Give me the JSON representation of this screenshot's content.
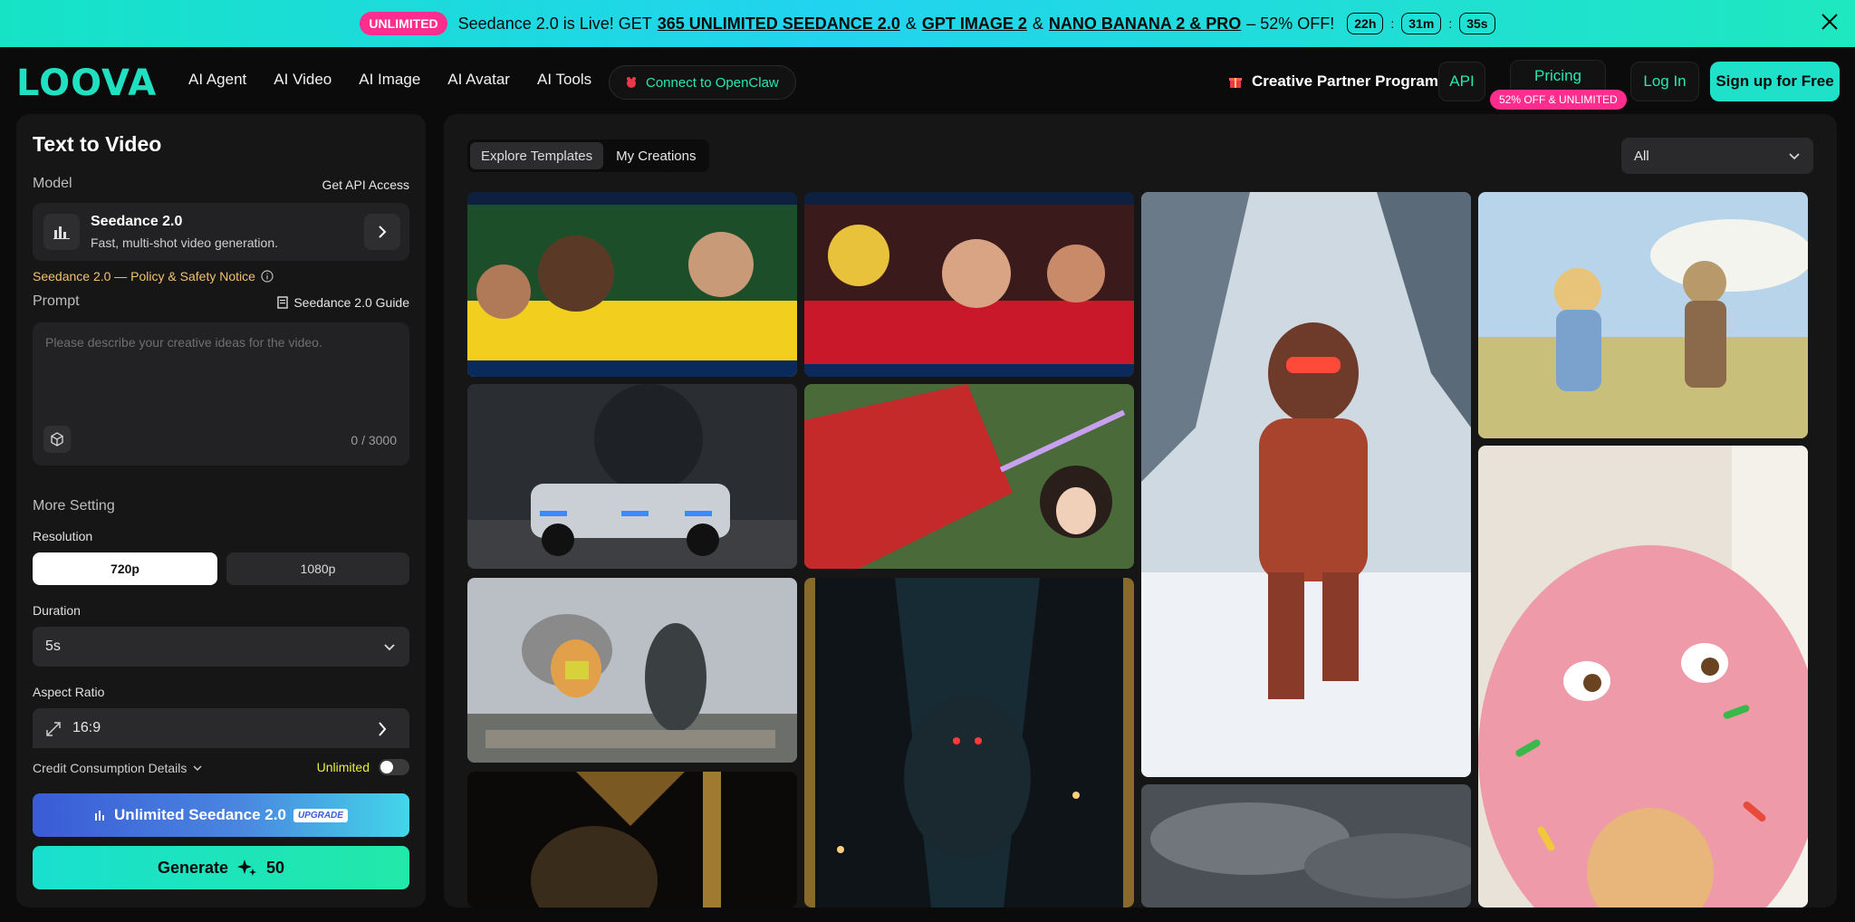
{
  "promo": {
    "badge": "UNLIMITED",
    "text_pre": "Seedance 2.0 is Live! GET",
    "link1": "365 UNLIMITED SEEDANCE 2.0",
    "amp1": "&",
    "link2": "GPT IMAGE 2",
    "amp2": "&",
    "link3": "NANO BANANA 2 & PRO",
    "text_post": "– 52% OFF!",
    "timer": {
      "hours": "22h",
      "minutes": "31m",
      "seconds": "35s",
      "sep": ":"
    }
  },
  "nav": {
    "logo": "LOOVA",
    "links": [
      "AI Agent",
      "AI Video",
      "AI Image",
      "AI Avatar",
      "AI Tools"
    ],
    "openclaw": "Connect to OpenClaw",
    "partner": "Creative Partner Program",
    "api": "API",
    "pricing": "Pricing",
    "pricing_badge": "52% OFF & UNLIMITED",
    "login": "Log In",
    "signup": "Sign up for Free"
  },
  "panel": {
    "title": "Text to Video",
    "model_label": "Model",
    "api_access": "Get API Access",
    "model_name": "Seedance 2.0",
    "model_desc": "Fast, multi-shot video generation.",
    "policy": "Seedance 2.0 — Policy & Safety Notice",
    "prompt_label": "Prompt",
    "guide": "Seedance 2.0 Guide",
    "prompt_placeholder": "Please describe your creative ideas for the video.",
    "counter": "0 / 3000",
    "more_setting": "More Setting",
    "resolution_label": "Resolution",
    "res_options": [
      "720p",
      "1080p"
    ],
    "duration_label": "Duration",
    "duration_value": "5s",
    "aspect_label": "Aspect Ratio",
    "aspect_value": "16:9",
    "credit": "Credit Consumption Details",
    "unlimited": "Unlimited",
    "unlimited_btn": "Unlimited Seedance 2.0",
    "upgrade": "UPGRADE",
    "generate": "Generate",
    "generate_cost": "50"
  },
  "gallery": {
    "tabs": [
      "Explore Templates",
      "My Creations"
    ],
    "filter": "All",
    "tiles": [
      {
        "name": "template-brazil-fans"
      },
      {
        "name": "template-spain-fans"
      },
      {
        "name": "template-astronaut-snow"
      },
      {
        "name": "template-anime-countryside"
      },
      {
        "name": "template-armored-vehicle"
      },
      {
        "name": "template-anime-swordsman"
      },
      {
        "name": "template-donut-character"
      },
      {
        "name": "template-cat-vs-godzilla"
      },
      {
        "name": "template-dark-castle-creature"
      },
      {
        "name": "template-golden-warrior"
      },
      {
        "name": "template-stormy-sky"
      }
    ]
  },
  "colors": {
    "accent": "#1fe0c8",
    "pink": "#ff2d8e",
    "policy": "#f3c26b"
  }
}
